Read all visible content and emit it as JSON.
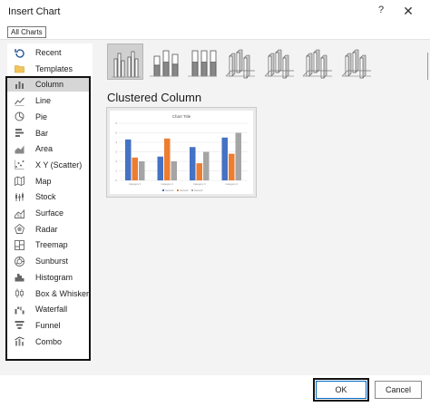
{
  "dialog": {
    "title": "Insert Chart",
    "help_glyph": "?",
    "close_glyph": "✕"
  },
  "tabs": [
    {
      "label": "All Charts"
    }
  ],
  "sidebar": {
    "items": [
      {
        "label": "Recent",
        "icon": "recent-icon"
      },
      {
        "label": "Templates",
        "icon": "folder-icon"
      },
      {
        "label": "Column",
        "icon": "column-chart-icon",
        "selected": true
      },
      {
        "label": "Line",
        "icon": "line-chart-icon"
      },
      {
        "label": "Pie",
        "icon": "pie-chart-icon"
      },
      {
        "label": "Bar",
        "icon": "bar-chart-icon"
      },
      {
        "label": "Area",
        "icon": "area-chart-icon"
      },
      {
        "label": "X Y (Scatter)",
        "icon": "scatter-chart-icon"
      },
      {
        "label": "Map",
        "icon": "map-chart-icon"
      },
      {
        "label": "Stock",
        "icon": "stock-chart-icon"
      },
      {
        "label": "Surface",
        "icon": "surface-chart-icon"
      },
      {
        "label": "Radar",
        "icon": "radar-chart-icon"
      },
      {
        "label": "Treemap",
        "icon": "treemap-chart-icon"
      },
      {
        "label": "Sunburst",
        "icon": "sunburst-chart-icon"
      },
      {
        "label": "Histogram",
        "icon": "histogram-chart-icon"
      },
      {
        "label": "Box & Whisker",
        "icon": "box-whisker-chart-icon"
      },
      {
        "label": "Waterfall",
        "icon": "waterfall-chart-icon"
      },
      {
        "label": "Funnel",
        "icon": "funnel-chart-icon"
      },
      {
        "label": "Combo",
        "icon": "combo-chart-icon"
      }
    ]
  },
  "subtypes": {
    "selected_title": "Clustered Column",
    "items": [
      {
        "icon": "clustered-column-icon",
        "selected": true
      },
      {
        "icon": "stacked-column-icon"
      },
      {
        "icon": "100-stacked-column-icon"
      },
      {
        "icon": "3d-clustered-column-icon"
      },
      {
        "icon": "3d-stacked-column-icon"
      },
      {
        "icon": "3d-100-stacked-column-icon"
      },
      {
        "icon": "3d-column-icon"
      }
    ]
  },
  "preview": {
    "chart_title": "Chart Title",
    "categories": [
      "Category 1",
      "Category 2",
      "Category 3",
      "Category 4"
    ],
    "series": [
      {
        "name": "Series1",
        "values": [
          4.3,
          2.5,
          3.5,
          4.5
        ]
      },
      {
        "name": "Series2",
        "values": [
          2.4,
          4.4,
          1.8,
          2.8
        ]
      },
      {
        "name": "Series3",
        "values": [
          2,
          2,
          3,
          5
        ]
      }
    ],
    "ylim": [
      0,
      6
    ],
    "colors": [
      "#4472c4",
      "#ed7d31",
      "#a5a5a5"
    ]
  },
  "footer": {
    "ok_label": "OK",
    "cancel_label": "Cancel"
  }
}
